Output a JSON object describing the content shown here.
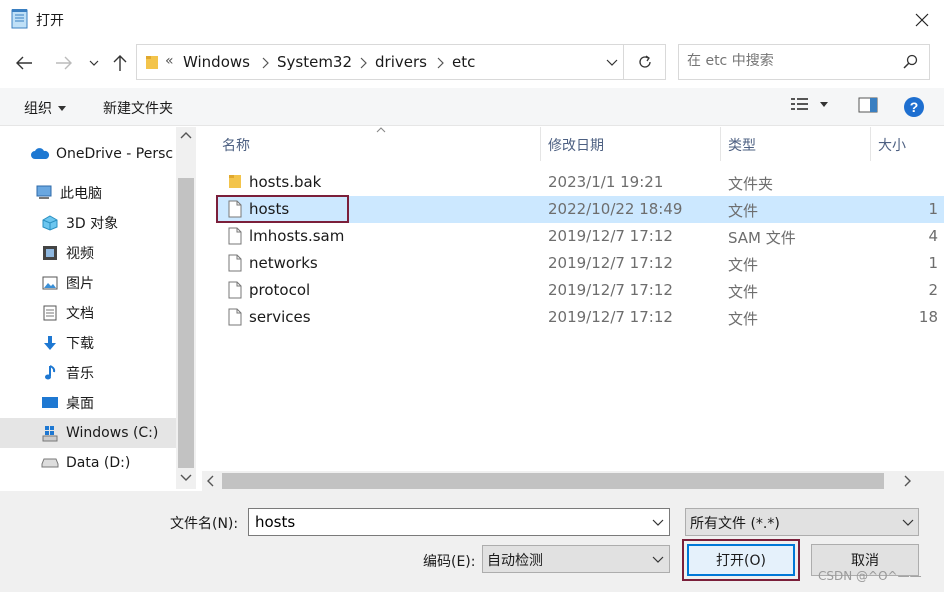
{
  "window": {
    "title": "打开",
    "close_label": "✕"
  },
  "address": {
    "overflow_chevron": "«",
    "crumbs": [
      "Windows",
      "System32",
      "drivers",
      "etc"
    ]
  },
  "search": {
    "placeholder": "在 etc 中搜索"
  },
  "toolbar": {
    "organize_label": "组织",
    "new_folder_label": "新建文件夹"
  },
  "nav": {
    "items": [
      {
        "label": "OneDrive - Persc",
        "icon": "cloud-icon"
      },
      {
        "label": "此电脑",
        "icon": "computer-icon"
      },
      {
        "label": "3D 对象",
        "icon": "cube-icon"
      },
      {
        "label": "视频",
        "icon": "video-icon"
      },
      {
        "label": "图片",
        "icon": "picture-icon"
      },
      {
        "label": "文档",
        "icon": "document-icon"
      },
      {
        "label": "下载",
        "icon": "download-icon"
      },
      {
        "label": "音乐",
        "icon": "music-icon"
      },
      {
        "label": "桌面",
        "icon": "desktop-icon"
      },
      {
        "label": "Windows (C:)",
        "icon": "system-drive-icon",
        "selected": true
      },
      {
        "label": "Data (D:)",
        "icon": "drive-icon"
      }
    ]
  },
  "files": {
    "columns": {
      "name": "名称",
      "date": "修改日期",
      "type": "类型",
      "size": "大小"
    },
    "rows": [
      {
        "name": "hosts.bak",
        "date": "2023/1/1 19:21",
        "type": "文件夹",
        "size": "",
        "icon": "folder-icon"
      },
      {
        "name": "hosts",
        "date": "2022/10/22 18:49",
        "type": "文件",
        "size": "1",
        "icon": "file-icon",
        "selected": true
      },
      {
        "name": "lmhosts.sam",
        "date": "2019/12/7 17:12",
        "type": "SAM 文件",
        "size": "4",
        "icon": "file-icon"
      },
      {
        "name": "networks",
        "date": "2019/12/7 17:12",
        "type": "文件",
        "size": "1",
        "icon": "file-icon"
      },
      {
        "name": "protocol",
        "date": "2019/12/7 17:12",
        "type": "文件",
        "size": "2",
        "icon": "file-icon"
      },
      {
        "name": "services",
        "date": "2019/12/7 17:12",
        "type": "文件",
        "size": "18",
        "icon": "file-icon"
      }
    ]
  },
  "bottom": {
    "filename_label": "文件名(N):",
    "filename_value": "hosts",
    "filter_value": "所有文件 (*.*)",
    "encoding_label": "编码(E):",
    "encoding_value": "自动检测",
    "open_label": "打开(O)",
    "cancel_label": "取消"
  },
  "watermark": "CSDN @^O^——",
  "colors": {
    "accent": "#0078d7",
    "selection": "#cce8ff",
    "highlight_box": "#7b1f3a"
  }
}
